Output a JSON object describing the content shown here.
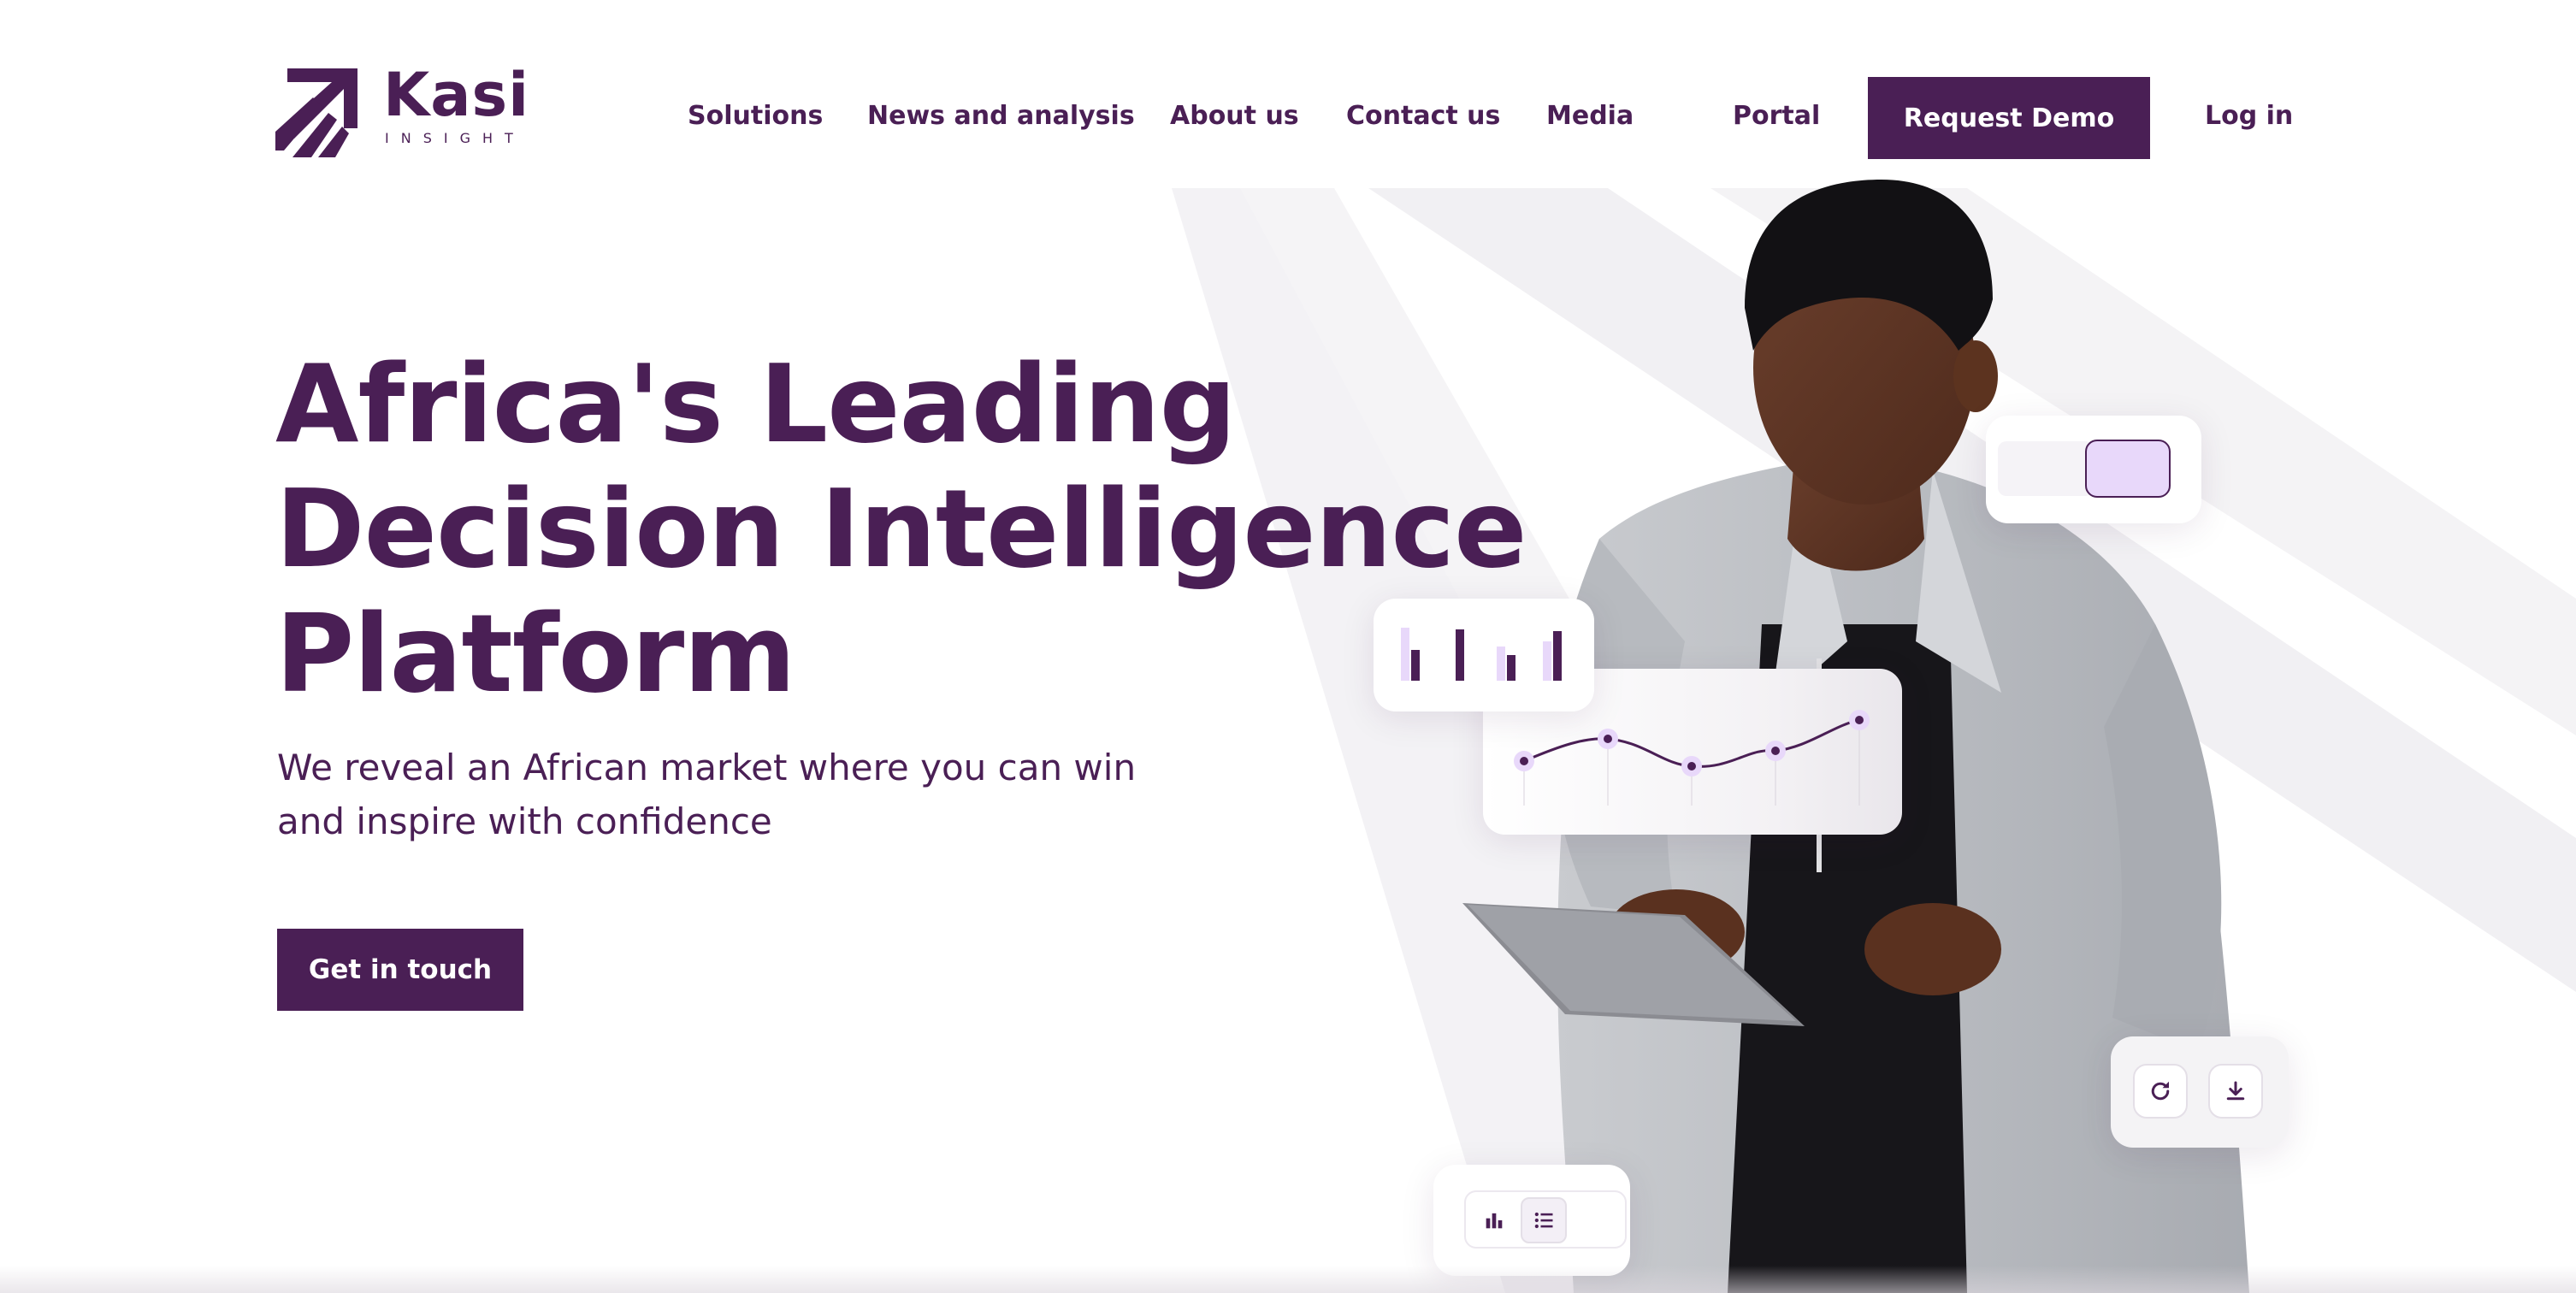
{
  "brand": {
    "name": "Kasi",
    "tagline": "INSIGHT",
    "logo_icon": "kasi-arrow-logo",
    "primary_color": "#4a1f55",
    "accent_color": "#e8d8fa"
  },
  "nav": {
    "items": [
      {
        "label": "Solutions"
      },
      {
        "label": "News and analysis"
      },
      {
        "label": "About us"
      },
      {
        "label": "Contact us"
      },
      {
        "label": "Media"
      },
      {
        "label": "Portal"
      }
    ],
    "demo_label": "Request Demo",
    "login_label": "Log in"
  },
  "hero": {
    "title_lines": [
      "Africa's Leading",
      "Decision Intelligence",
      "Platform"
    ],
    "subtitle_lines": [
      "We reveal an African market where you can win",
      "and inspire with confidence"
    ],
    "cta_label": "Get in touch"
  },
  "widgets": {
    "actions": {
      "refresh_icon": "refresh-icon",
      "download_icon": "download-icon"
    },
    "view_switch": {
      "chart_icon": "bar-chart-icon",
      "list_icon": "list-icon"
    }
  }
}
